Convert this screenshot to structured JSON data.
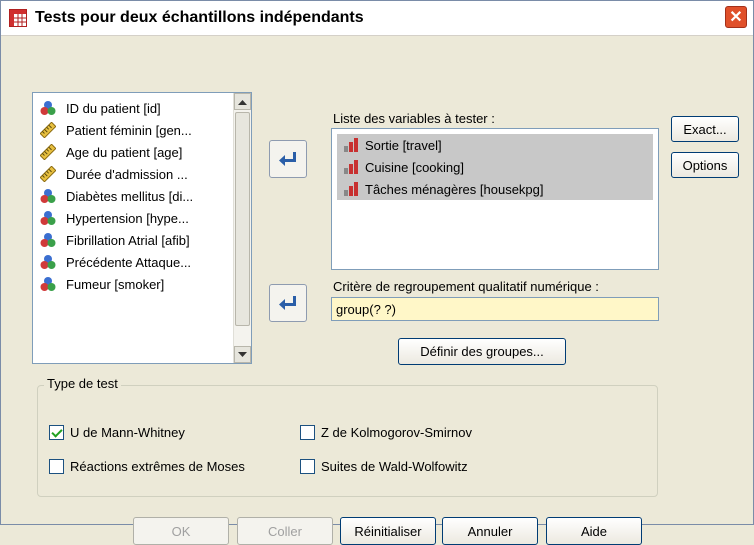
{
  "window": {
    "title": "Tests pour deux échantillons indépendants"
  },
  "source_variables": [
    {
      "label": "ID du patient [id]",
      "icon": "nominal-icon"
    },
    {
      "label": "Patient féminin [gen...",
      "icon": "scale-icon"
    },
    {
      "label": "Age du patient [age]",
      "icon": "scale-icon"
    },
    {
      "label": "Durée d'admission ...",
      "icon": "scale-icon"
    },
    {
      "label": "Diabètes mellitus [di...",
      "icon": "nominal-icon"
    },
    {
      "label": "Hypertension [hype...",
      "icon": "nominal-icon"
    },
    {
      "label": "Fibrillation Atrial  [afib]",
      "icon": "nominal-icon"
    },
    {
      "label": "Précédente Attaque...",
      "icon": "nominal-icon"
    },
    {
      "label": "Fumeur [smoker]",
      "icon": "nominal-icon"
    }
  ],
  "test_list": {
    "label": "Liste des variables à tester :",
    "items": [
      "Sortie [travel]",
      "Cuisine [cooking]",
      "Tâches ménagères [housekpg]"
    ]
  },
  "grouping": {
    "label": "Critère de regroupement qualitatif numérique :",
    "value": "group(? ?)",
    "define_button": "Définir des groupes..."
  },
  "side_buttons": {
    "exact": "Exact...",
    "options": "Options"
  },
  "test_type": {
    "title": "Type de test",
    "mann_whitney": {
      "label": "U de Mann-Whitney",
      "checked": true
    },
    "kolmogorov": {
      "label": "Z de Kolmogorov-Smirnov",
      "checked": false
    },
    "moses": {
      "label": "Réactions extrêmes de Moses",
      "checked": false
    },
    "wald": {
      "label": "Suites de Wald-Wolfowitz",
      "checked": false
    }
  },
  "footer": {
    "ok": "OK",
    "paste": "Coller",
    "reset": "Réinitialiser",
    "cancel": "Annuler",
    "help": "Aide"
  },
  "colors": {
    "close": "#e0502a",
    "highlight_field": "#fff7c8",
    "selected_item": "#c8c8c8"
  }
}
